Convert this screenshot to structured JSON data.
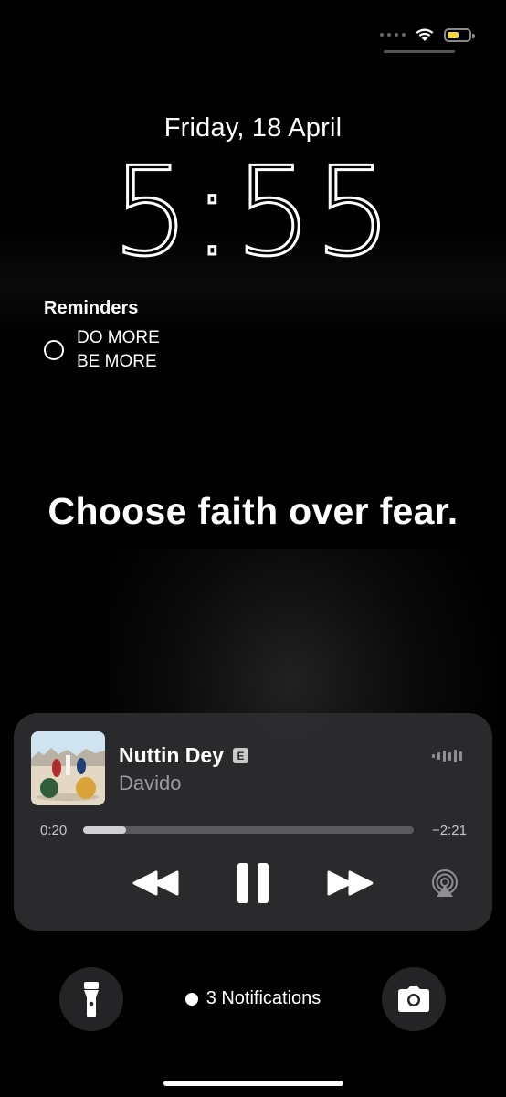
{
  "status": {
    "signal_icon": "cellular-dots-icon",
    "wifi_icon": "wifi-icon",
    "battery_icon": "battery-icon",
    "battery_color": "#f6d743",
    "battery_level_fraction": 0.45
  },
  "lockscreen": {
    "date": "Friday, 18 April",
    "time": "5:55"
  },
  "widget": {
    "title": "Reminders",
    "reminder_line1": "DO MORE",
    "reminder_line2": "BE MORE"
  },
  "quote": "Choose faith over fear.",
  "now_playing": {
    "title": "Nuttin Dey",
    "explicit_badge": "E",
    "artist": "Davido",
    "elapsed": "0:20",
    "remaining": "−2:21",
    "progress_fraction": 0.13,
    "controls": [
      "rewind-icon",
      "pause-icon",
      "fast-forward-icon",
      "airplay-icon"
    ]
  },
  "bottom": {
    "flashlight_icon": "flashlight-icon",
    "camera_icon": "camera-icon",
    "notifications": "3 Notifications"
  }
}
